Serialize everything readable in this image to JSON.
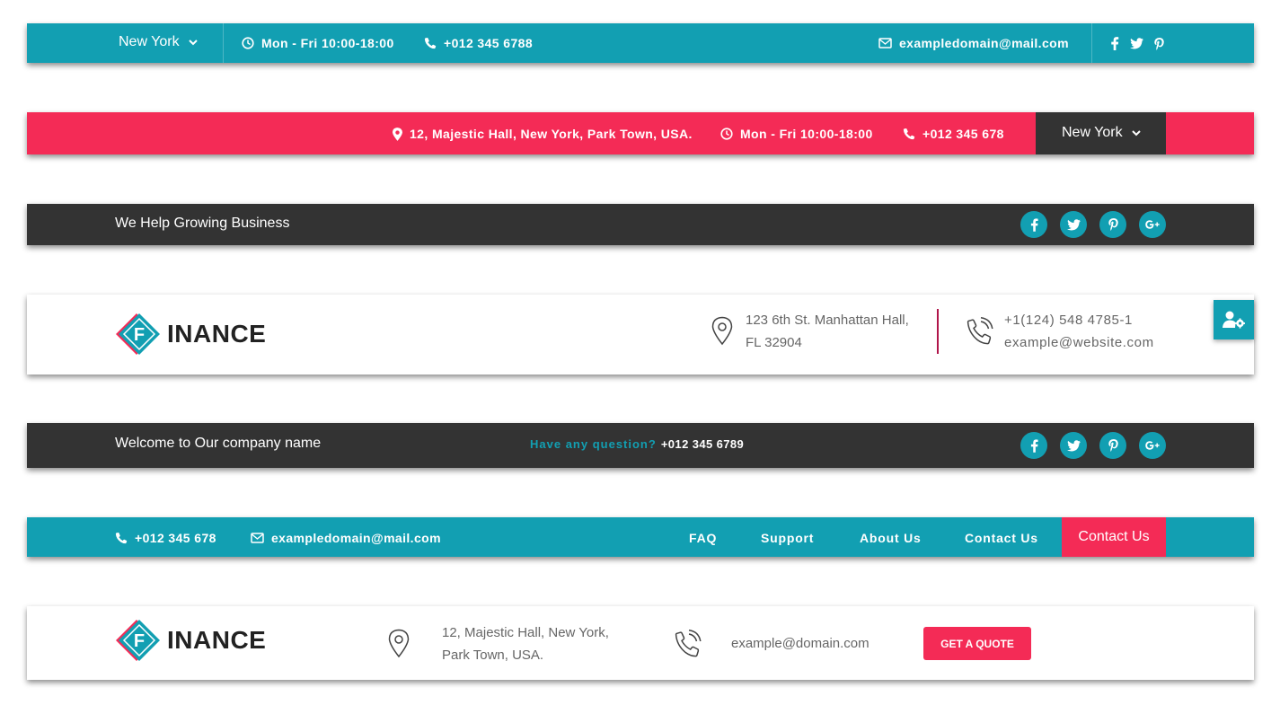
{
  "colors": {
    "teal": "#129fb2",
    "pink": "#f42b56",
    "dark": "#333333",
    "white": "#ffffff"
  },
  "bar1": {
    "city": "New York",
    "hours": "Mon - Fri 10:00-18:00",
    "phone": "+012 345 6788",
    "email": "exampledomain@mail.com",
    "social_icons": [
      "facebook-icon",
      "twitter-icon",
      "pinterest-icon"
    ]
  },
  "bar2": {
    "address": "12, Majestic Hall, New York, Park Town, USA.",
    "hours": "Mon - Fri 10:00-18:00",
    "phone": "+012 345 678",
    "city": "New York"
  },
  "bar3": {
    "tagline": "We Help Growing Business",
    "social_icons": [
      "facebook-icon",
      "twitter-icon",
      "pinterest-icon",
      "google-plus-icon"
    ]
  },
  "bar4": {
    "logo_letter": "F",
    "logo_text": "INANCE",
    "address_line1": "123 6th St. Manhattan Hall,",
    "address_line2": "FL 32904",
    "phone": "+1(124) 548 4785-1",
    "email": "example@website.com",
    "settings_icon": "user-settings-icon"
  },
  "bar5": {
    "welcome": "Welcome to Our company name",
    "question": "Have any question?",
    "phone": "+012 345 6789",
    "social_icons": [
      "facebook-icon",
      "twitter-icon",
      "pinterest-icon",
      "google-plus-icon"
    ]
  },
  "bar6": {
    "phone": "+012 345 678",
    "email": "exampledomain@mail.com",
    "nav": [
      "FAQ",
      "Support",
      "About Us",
      "Contact Us"
    ],
    "cta": "Contact Us"
  },
  "bar7": {
    "logo_letter": "F",
    "logo_text": "INANCE",
    "address_line1": "12, Majestic Hall, New York,",
    "address_line2": "Park Town, USA.",
    "email": "example@domain.com",
    "cta": "GET A QUOTE"
  }
}
